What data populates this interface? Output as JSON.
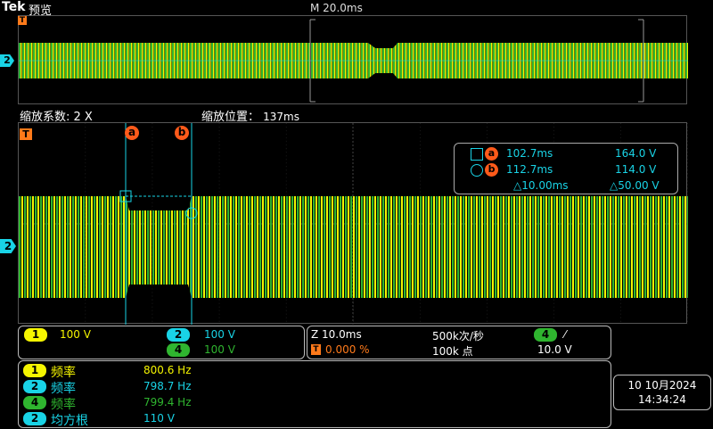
{
  "header": {
    "brand": "Tek",
    "mode": "预览",
    "timebase": "M 20.0ms"
  },
  "overview": {
    "trigger_marker": "T",
    "channel_marker": "2"
  },
  "zoom": {
    "factor_label": "缩放系数:",
    "factor_value": "2 X",
    "position_label": "缩放位置：",
    "position_value": "137ms",
    "trigger_marker": "T",
    "channel_marker": "2",
    "cursor_a_label": "a",
    "cursor_b_label": "b"
  },
  "cursor_readout": {
    "a_label": "a",
    "a_time": "102.7ms",
    "a_value": "164.0 V",
    "b_label": "b",
    "b_time": "112.7ms",
    "b_value": "114.0 V",
    "delta_time": "△10.00ms",
    "delta_value": "△50.00 V"
  },
  "channels": {
    "ch1_num": "1",
    "ch1_scale": "100 V",
    "ch2_num": "2",
    "ch2_scale": "100 V",
    "ch4_num": "4",
    "ch4_scale": "100 V"
  },
  "acquisition": {
    "zoom_timebase": "Z 10.0ms",
    "trig_marker": "T",
    "trig_pos": "0.000 %",
    "sample_rate": "500k次/秒",
    "record_length": "100k 点",
    "trig_source": "4",
    "trig_slope": "⁄",
    "trig_level": "10.0 V"
  },
  "measurements": [
    {
      "ch": "1",
      "name": "频率",
      "value": "800.6 Hz",
      "color": "#f5f500"
    },
    {
      "ch": "2",
      "name": "频率",
      "value": "798.7 Hz",
      "color": "#19d3e6"
    },
    {
      "ch": "4",
      "name": "频率",
      "value": "799.4 Hz",
      "color": "#2fb52f"
    },
    {
      "ch": "2",
      "name": "均方根",
      "value": "110 V",
      "color": "#19d3e6"
    }
  ],
  "datetime": {
    "date": "10 10月2024",
    "time": "14:34:24"
  },
  "colors": {
    "ch1": "#f5f500",
    "ch2": "#19d3e6",
    "ch4": "#2fb52f",
    "accent": "#ff7a1a"
  }
}
